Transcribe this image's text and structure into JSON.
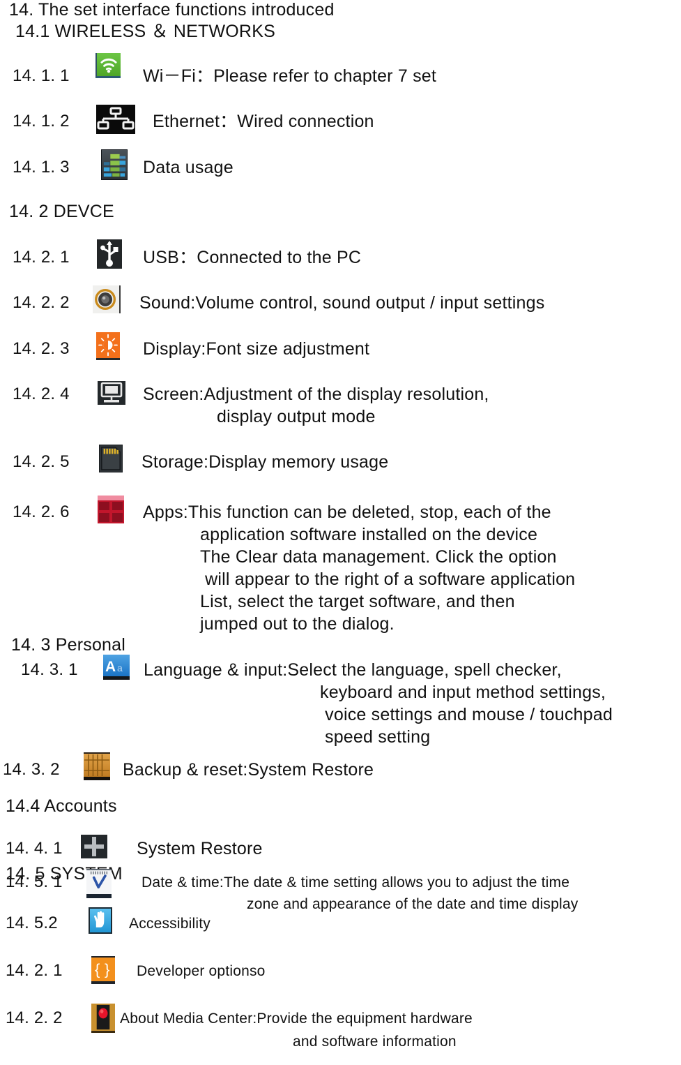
{
  "document": {
    "title": "14. The set interface functions introduced"
  },
  "sections": {
    "wireless": {
      "heading": "14.1 WIRELESS ＆ NETWORKS",
      "items": [
        {
          "number": "14. 1. 1",
          "icon": "wifi-icon",
          "text": "Wi－Fi：Please refer to chapter 7 set"
        },
        {
          "number": "14. 1. 2",
          "icon": "ethernet-icon",
          "text": "Ethernet：Wired connection"
        },
        {
          "number": "14. 1. 3",
          "icon": "data-usage-icon",
          "text": "Data usage"
        }
      ]
    },
    "device": {
      "heading": "14. 2 DEVCE",
      "items": [
        {
          "number": "14. 2. 1",
          "icon": "usb-icon",
          "text": "USB：Connected to the PC",
          "lines": []
        },
        {
          "number": "14. 2. 2",
          "icon": "sound-icon",
          "text": "Sound:Volume control, sound output / input settings",
          "lines": []
        },
        {
          "number": "14. 2. 3",
          "icon": "display-icon",
          "text": "Display:Font size adjustment",
          "lines": []
        },
        {
          "number": "14. 2. 4",
          "icon": "screen-icon",
          "text": "Screen:Adjustment of the display resolution,",
          "lines": [
            "display output mode"
          ]
        },
        {
          "number": "14. 2. 5",
          "icon": "storage-icon",
          "text": "Storage:Display memory usage",
          "lines": []
        },
        {
          "number": "14. 2. 6",
          "icon": "apps-icon",
          "text": "Apps:This function can be deleted, stop, each of the",
          "lines": [
            "application software installed on the device",
            "The Clear data management. Click the option",
            " will appear to the right of a software application",
            "List, select the target software, and then",
            "jumped out to the dialog."
          ]
        }
      ]
    },
    "personal": {
      "heading": "14. 3 Personal",
      "items": [
        {
          "number": "14. 3. 1",
          "icon": "language-icon",
          "text": "Language & input:Select the language, spell checker,",
          "lines": [
            "keyboard and input method settings,",
            " voice settings and mouse / touchpad",
            "speed setting"
          ]
        },
        {
          "number": "14. 3. 2",
          "icon": "backup-icon",
          "text": "Backup & reset:System Restore",
          "lines": []
        }
      ]
    },
    "accounts": {
      "heading": "14.4 Accounts",
      "items": [
        {
          "number": "14. 4. 1",
          "icon": "plus-icon",
          "text": "System Restore",
          "lines": []
        }
      ]
    },
    "system": {
      "heading": "14. 5 SYSTEM",
      "items": [
        {
          "number": "14. 5. 1",
          "icon": "date-time-icon",
          "text": "Date & time:The date & time setting allows you to adjust the time",
          "lines": [
            "zone and appearance of the date and time display"
          ]
        },
        {
          "number": "14. 5.2",
          "icon": "accessibility-icon",
          "text": "Accessibility",
          "lines": []
        },
        {
          "number": "14. 2. 1",
          "icon": "developer-options-icon",
          "text": "Developer optionso",
          "lines": []
        },
        {
          "number": "14. 2. 2",
          "icon": "about-media-center-icon",
          "text": "About Media Center:Provide the equipment hardware",
          "lines": [
            "and software information"
          ]
        }
      ]
    }
  },
  "colors": {
    "wifi_green": "#6cc644",
    "display_orange": "#f3701b",
    "apps_red": "#c2162c",
    "language_blue": "#1b74c6",
    "accessibility_blue": "#2196d4",
    "developer_orange": "#f3901d",
    "backup_wood": "#c07c22",
    "text": "#111111"
  }
}
